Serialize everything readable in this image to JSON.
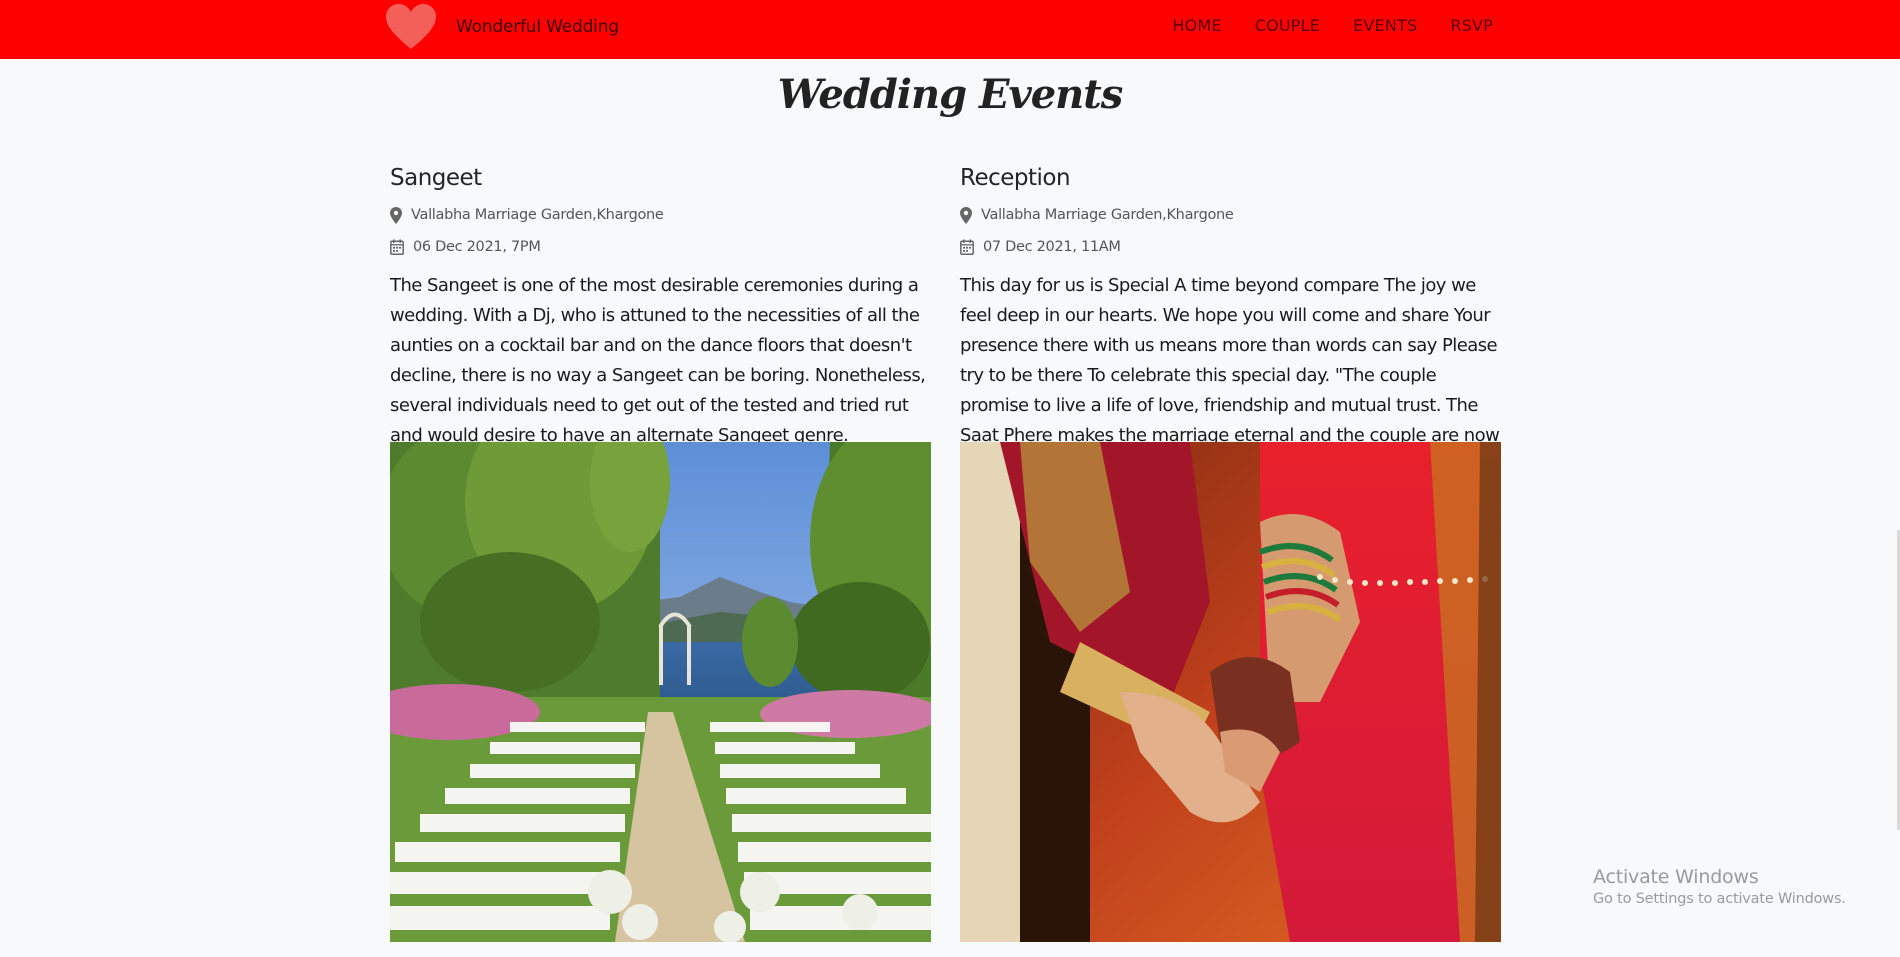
{
  "navbar": {
    "brand": "Wonderful Wedding",
    "links": [
      "HOME",
      "COUPLE",
      "EVENTS",
      "RSVP"
    ],
    "colors": {
      "background": "#ff0000",
      "heart": "#f26059"
    }
  },
  "page_title": "Wedding Events",
  "events": [
    {
      "title": "Sangeet",
      "location": "Vallabha Marriage Garden,Khargone",
      "date": "06 Dec 2021, 7PM",
      "description": "The Sangeet is one of the most desirable ceremonies during a wedding. With a Dj, who is attuned to the necessities of all the aunties on a cocktail bar and on the dance floors that doesn't decline, there is no way a Sangeet can be boring. Nonetheless, several individuals need to get out of the tested and tried rut and would desire to have an alternate Sangeet genre."
    },
    {
      "title": "Reception",
      "location": "Vallabha Marriage Garden,Khargone",
      "date": "07 Dec 2021, 11AM",
      "description": "This day for us is Special A time beyond compare The joy we feel deep in our hearts. We hope you will come and share Your presence there with us means more than words can say Please try to be there To celebrate this special day. \"The couple promise to live a life of love, friendship and mutual trust. The Saat Phere makes the marriage eternal and the couple are now officially husband and wife.\""
    }
  ],
  "icons": {
    "location": "map-marker-icon",
    "date": "calendar-icon",
    "brand": "heart-icon"
  },
  "watermark": {
    "line1": "Activate Windows",
    "line2": "Go to Settings to activate Windows."
  }
}
